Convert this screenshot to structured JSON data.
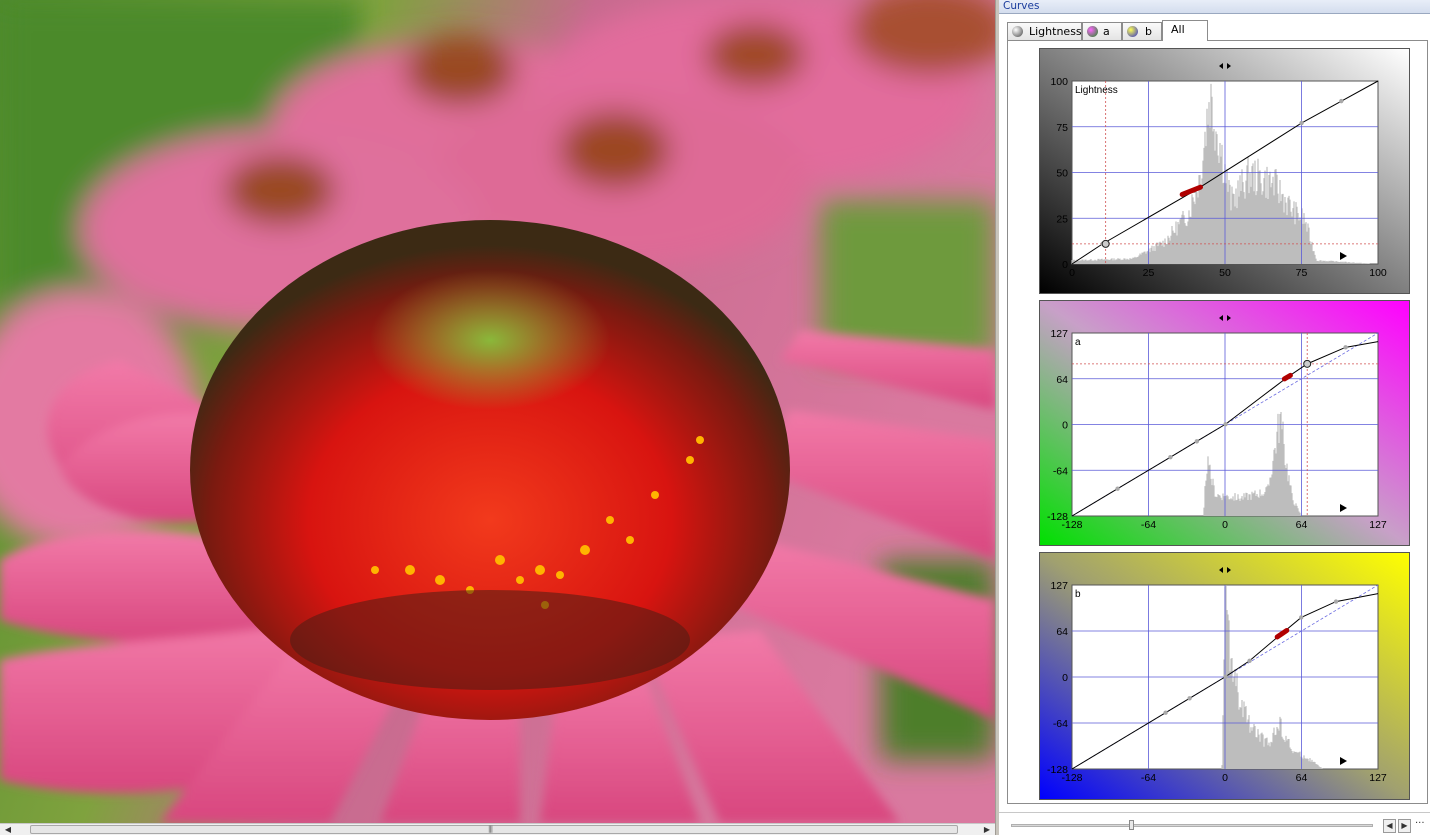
{
  "panel": {
    "title": "Curves"
  },
  "tabs": [
    {
      "label": "Lightness",
      "icon": "lightness-ball-icon",
      "active": false
    },
    {
      "label": "a",
      "icon": "a-channel-ball-icon",
      "active": false
    },
    {
      "label": "b",
      "icon": "b-channel-ball-icon",
      "active": false
    },
    {
      "label": "All",
      "icon": "",
      "active": true
    }
  ],
  "curves": [
    {
      "channel": "Lightness",
      "name": "Lightness",
      "x_ticks": [
        "0",
        "25",
        "50",
        "75",
        "100"
      ],
      "y_ticks": [
        "100",
        "75",
        "50",
        "25",
        "0"
      ],
      "range": [
        0,
        100
      ],
      "frame_colors": [
        "#000000",
        "#ffffff"
      ],
      "curve_points": [
        [
          0,
          0
        ],
        [
          10,
          11
        ],
        [
          40,
          40
        ],
        [
          75,
          77
        ],
        [
          88,
          89
        ],
        [
          100,
          100
        ]
      ],
      "selected_segment": [
        [
          36,
          38
        ],
        [
          42,
          42
        ]
      ],
      "marker_point": [
        11,
        11
      ]
    },
    {
      "channel": "a",
      "name": "a",
      "x_ticks": [
        "-128",
        "-64",
        "0",
        "64",
        "127"
      ],
      "y_ticks": [
        "127",
        "64",
        "0",
        "-64",
        "-128"
      ],
      "range": [
        -128,
        127
      ],
      "frame_colors": [
        "#00e000",
        "#ff00ff"
      ],
      "curve_points": [
        [
          -128,
          -128
        ],
        [
          -90,
          -90
        ],
        [
          -46,
          -46
        ],
        [
          -24,
          -24
        ],
        [
          0,
          0
        ],
        [
          52,
          66
        ],
        [
          68,
          84
        ],
        [
          100,
          107
        ],
        [
          127,
          115
        ]
      ],
      "selected_segment": [
        [
          49,
          63
        ],
        [
          54,
          68
        ]
      ],
      "marker_point": [
        68,
        84
      ]
    },
    {
      "channel": "b",
      "name": "b",
      "x_ticks": [
        "-128",
        "-64",
        "0",
        "64",
        "127"
      ],
      "y_ticks": [
        "127",
        "64",
        "0",
        "-64",
        "-128"
      ],
      "range": [
        -128,
        127
      ],
      "frame_colors": [
        "#0000ff",
        "#ffff00"
      ],
      "curve_points": [
        [
          -128,
          -128
        ],
        [
          -50,
          -50
        ],
        [
          -30,
          -30
        ],
        [
          0,
          0
        ],
        [
          20,
          22
        ],
        [
          47,
          60
        ],
        [
          63,
          82
        ],
        [
          92,
          104
        ],
        [
          127,
          115
        ]
      ],
      "selected_segment": [
        [
          43,
          55
        ],
        [
          51,
          64
        ]
      ],
      "marker_point": null
    }
  ],
  "colors": {
    "title_text": "#1a3c9c",
    "grid": "#5a5ad8",
    "histogram": "#bdbdbd",
    "selected_point": "#b00000"
  }
}
